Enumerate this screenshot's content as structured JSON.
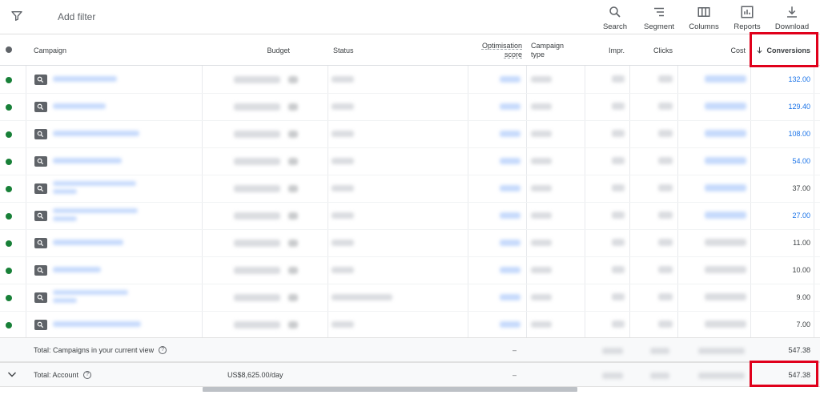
{
  "toolbar": {
    "add_filter": "Add filter",
    "tools": [
      {
        "label": "Search",
        "icon": "search-icon"
      },
      {
        "label": "Segment",
        "icon": "segment-icon"
      },
      {
        "label": "Columns",
        "icon": "columns-icon"
      },
      {
        "label": "Reports",
        "icon": "reports-icon"
      },
      {
        "label": "Download",
        "icon": "download-icon"
      }
    ]
  },
  "columns": {
    "campaign": "Campaign",
    "budget": "Budget",
    "status": "Status",
    "optimisation_score": "Optimisation score",
    "campaign_type": "Campaign type",
    "impr": "Impr.",
    "clicks": "Clicks",
    "cost": "Cost",
    "conversions": "Conversions"
  },
  "rows": [
    {
      "conversions": "132.00",
      "conv_link": true
    },
    {
      "conversions": "129.40",
      "conv_link": true
    },
    {
      "conversions": "108.00",
      "conv_link": true
    },
    {
      "conversions": "54.00",
      "conv_link": true
    },
    {
      "conversions": "37.00",
      "conv_link": false
    },
    {
      "conversions": "27.00",
      "conv_link": true
    },
    {
      "conversions": "11.00",
      "conv_link": false
    },
    {
      "conversions": "10.00",
      "conv_link": false
    },
    {
      "conversions": "9.00",
      "conv_link": false
    },
    {
      "conversions": "7.00",
      "conv_link": false
    }
  ],
  "totals": {
    "current_view_label": "Total: Campaigns in your current view",
    "current_view_opt": "–",
    "current_view_conversions": "547.38",
    "account_label": "Total: Account",
    "account_budget": "US$8,625.00/day",
    "account_opt": "–",
    "account_conversions": "547.38"
  },
  "colors": {
    "accent": "#1a73e8",
    "status_enabled": "#188038",
    "highlight": "#e0001b"
  }
}
